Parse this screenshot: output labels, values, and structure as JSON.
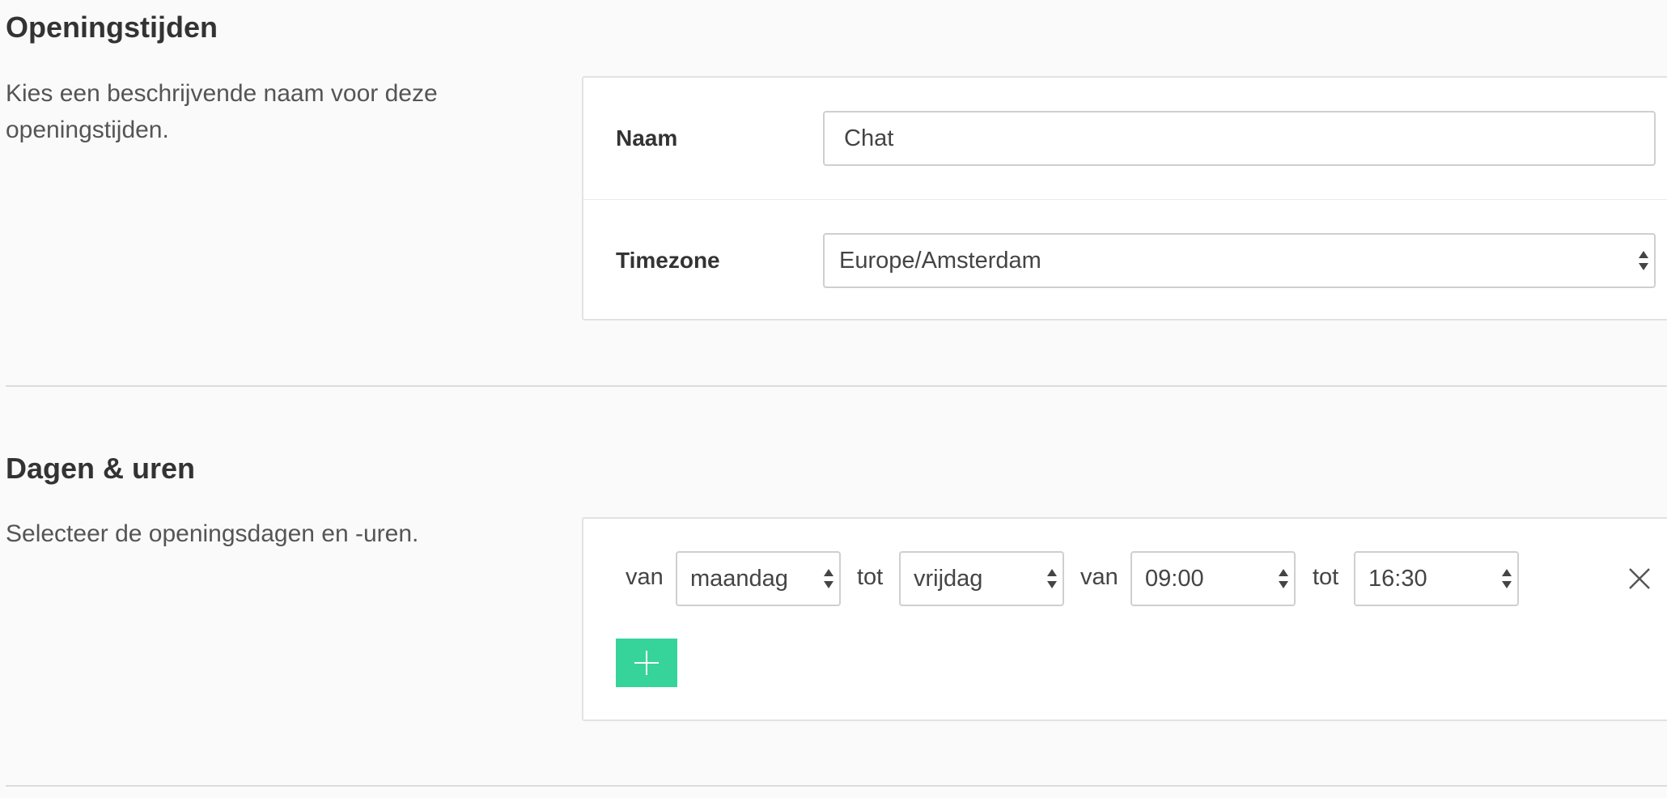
{
  "opening_hours": {
    "title": "Openingstijden",
    "description": "Kies een beschrijvende naam voor deze openingstijden.",
    "name_label": "Naam",
    "name_value": "Chat",
    "timezone_label": "Timezone",
    "timezone_value": "Europe/Amsterdam"
  },
  "days_hours": {
    "title": "Dagen & uren",
    "description": "Selecteer de openingsdagen en -uren.",
    "rule": {
      "from_word": "van",
      "from_day": "maandag",
      "to_word": "tot",
      "to_day": "vrijdag",
      "from_time_word": "van",
      "from_time": "09:00",
      "to_time_word": "tot",
      "to_time": "16:30"
    },
    "remove_icon": "close-icon",
    "add_icon": "plus-icon",
    "add_button_color": "#36d39a"
  }
}
